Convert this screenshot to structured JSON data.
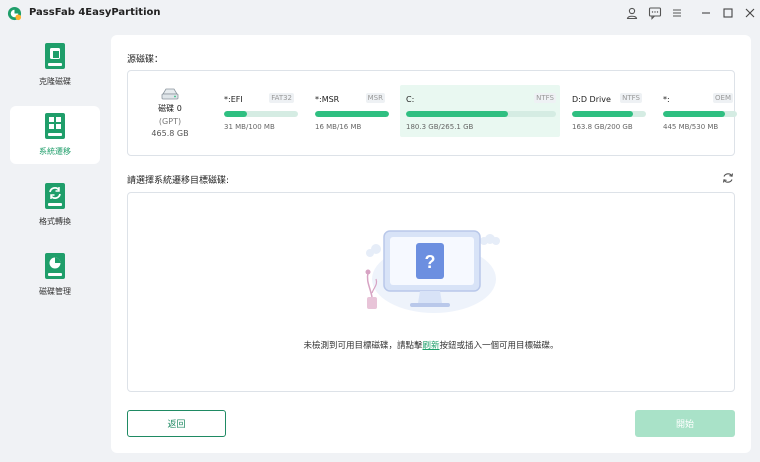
{
  "app": {
    "title": "PassFab 4EasyPartition"
  },
  "titlebar": {
    "icons": [
      "user-icon",
      "feedback-icon",
      "menu-icon",
      "minimize-icon",
      "maximize-icon",
      "close-icon"
    ]
  },
  "sidebar": {
    "items": [
      {
        "label": "克隆磁碟",
        "icon": "clone-disk-icon",
        "active": false
      },
      {
        "label": "系統遷移",
        "icon": "system-migrate-icon",
        "active": true
      },
      {
        "label": "格式轉換",
        "icon": "format-convert-icon",
        "active": false
      },
      {
        "label": "磁碟管理",
        "icon": "disk-manage-icon",
        "active": false
      }
    ]
  },
  "source": {
    "label": "源磁碟：",
    "disk": {
      "name": "磁碟 0",
      "style": "(GPT)",
      "size": "465.8 GB"
    },
    "partitions": [
      {
        "name": "*:EFI",
        "fs": "FAT32",
        "capacity": "31 MB/100 MB",
        "used_fraction": 0.31,
        "selected": false
      },
      {
        "name": "*:MSR",
        "fs": "MSR",
        "capacity": "16 MB/16 MB",
        "used_fraction": 1.0,
        "selected": false
      },
      {
        "name": "C:",
        "fs": "NTFS",
        "capacity": "180.3 GB/265.1 GB",
        "used_fraction": 0.68,
        "selected": true
      },
      {
        "name": "D:D Drive",
        "fs": "NTFS",
        "capacity": "163.8 GB/200 GB",
        "used_fraction": 0.82,
        "selected": false
      },
      {
        "name": "*:",
        "fs": "OEM",
        "capacity": "445 MB/530 MB",
        "used_fraction": 0.84,
        "selected": false
      }
    ]
  },
  "target": {
    "label": "請選擇系統遷移目標磁碟:",
    "message_before": "未檢測到可用目標磁碟，請點擊",
    "message_link": "刷新",
    "message_after": "按鈕或插入一個可用目標磁碟。"
  },
  "footer": {
    "back_label": "返回",
    "start_label": "開始"
  },
  "colors": {
    "accent": "#1f9e6a",
    "bar_fill": "#2fbf81",
    "start_disabled": "#a9e2c8"
  }
}
